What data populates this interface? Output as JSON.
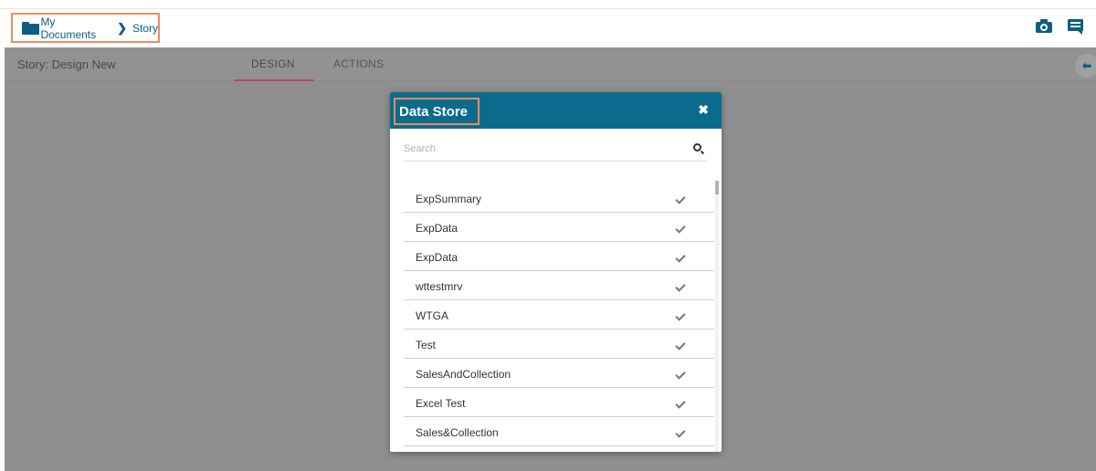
{
  "breadcrumb": {
    "root": "My Documents",
    "separator": "❯",
    "current": "Story"
  },
  "subbar": {
    "story_title": "Story: Design New",
    "tabs": [
      {
        "label": "DESIGN"
      },
      {
        "label": "ACTIONS"
      }
    ],
    "back_glyph": "⬅"
  },
  "modal": {
    "title": "Data Store",
    "close_glyph": "✖",
    "search": {
      "placeholder": "Search",
      "value": ""
    },
    "items": [
      {
        "label": "ExpSummary"
      },
      {
        "label": "ExpData"
      },
      {
        "label": "ExpData"
      },
      {
        "label": "wttestmrv"
      },
      {
        "label": "WTGA"
      },
      {
        "label": "Test"
      },
      {
        "label": "SalesAndCollection"
      },
      {
        "label": "Excel Test"
      },
      {
        "label": "Sales&Collection"
      }
    ]
  },
  "colors": {
    "accent": "#0b6b8c",
    "highlight_border": "#f08a5d",
    "tab_underline": "#c4426a",
    "overlay": "#8f8f8f"
  },
  "icons": [
    "folder-icon",
    "chevron-right-icon",
    "camera-icon",
    "comment-icon",
    "back-arrow-icon",
    "close-icon",
    "search-icon",
    "check-icon"
  ]
}
